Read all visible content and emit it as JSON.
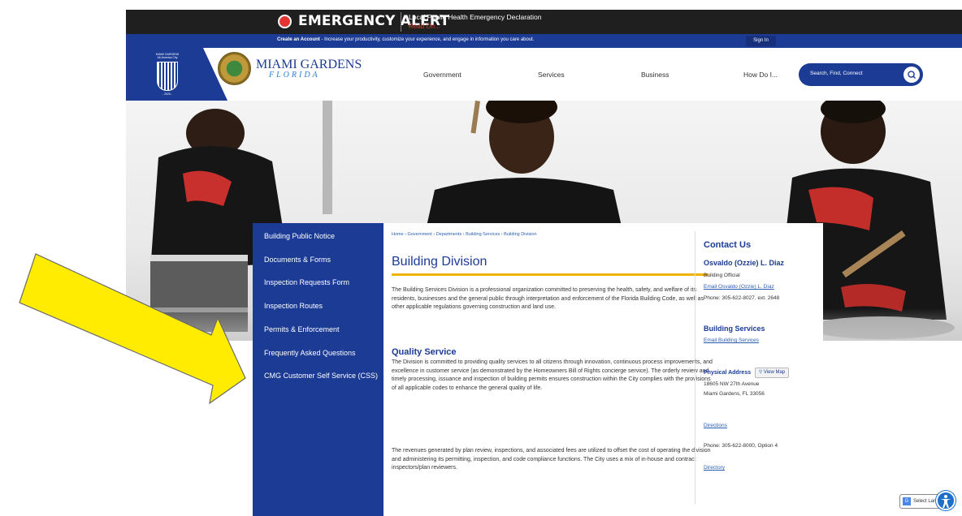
{
  "alert": {
    "title": "EMERGENCY ALERT",
    "message": "Local Public Health Emergency Declaration",
    "read_on": "Read On..."
  },
  "account_bar": {
    "create_account": "Create an Account",
    "tagline": " - Increase your productivity, customize your experience, and engage in information you care about.",
    "sign_in": "Sign In"
  },
  "header": {
    "badge_top": "MIAMI GARDENS All-America City",
    "badge_year": "- 2020 -",
    "logo_name": "MIAMI GARDENS",
    "logo_sub": "FLORIDA",
    "nav": [
      "Government",
      "Services",
      "Business",
      "How Do I..."
    ],
    "search_placeholder": "Search, Find, Connect"
  },
  "sidenav": {
    "items": [
      "Building Public Notice",
      "Documents & Forms",
      "Inspection Requests Form",
      "Inspection Routes",
      "Permits & Enforcement",
      "Frequently Asked Questions",
      "CMG Customer Self Service (CSS)"
    ]
  },
  "main": {
    "breadcrumb": "Home › Government › Departments › Building Services › Building Division",
    "title": "Building Division",
    "intro": "The Building Services Division is a professional organization committed to preserving the health, safety, and welfare of its residents, businesses and the general public through interpretation and enforcement of the Florida Building Code, as well as other applicable regulations governing construction and land use.",
    "quality_heading": "Quality Service",
    "quality_text": "The Division is committed to providing quality services to all citizens through innovation, continuous process improvements, and excellence in customer service (as demonstrated by the Homeowners Bill of Rights concierge service). The orderly review and timely processing, issuance and inspection of building permits ensures construction within the City complies with the provisions of all applicable codes to enhance the general quality of life.",
    "revenue_text": "The revenues generated by plan review, inspections, and associated fees are utilized to offset the cost of operating the division and administering its permitting, inspection, and code compliance functions. The City uses a mix of in-house and contract inspectors/plan reviewers."
  },
  "contact": {
    "heading": "Contact Us",
    "name": "Osvaldo (Ozzie) L. Diaz",
    "role": "Building Official",
    "email_link": "Email Osvaldo (Ozzie) L. Diaz",
    "phone": "Phone: 305-622-8027, ext. 2648",
    "services_heading": "Building Services",
    "services_email": "Email Building Services",
    "address_label": "Physical Address",
    "view_map": "View Map",
    "address_line1": "18605 NW 27th Avenue",
    "address_line2": "Miami Gardens, FL 33056",
    "directions": "Directions",
    "phone2": "Phone: 305-622-8000, Option 4",
    "directory": "Directory"
  },
  "widgets": {
    "select_language": "Select Langu"
  },
  "colors": {
    "brand_blue": "#1b3b95",
    "accent_gold": "#f0b400",
    "alert_red": "#e53232",
    "arrow_yellow": "#ffec00"
  }
}
